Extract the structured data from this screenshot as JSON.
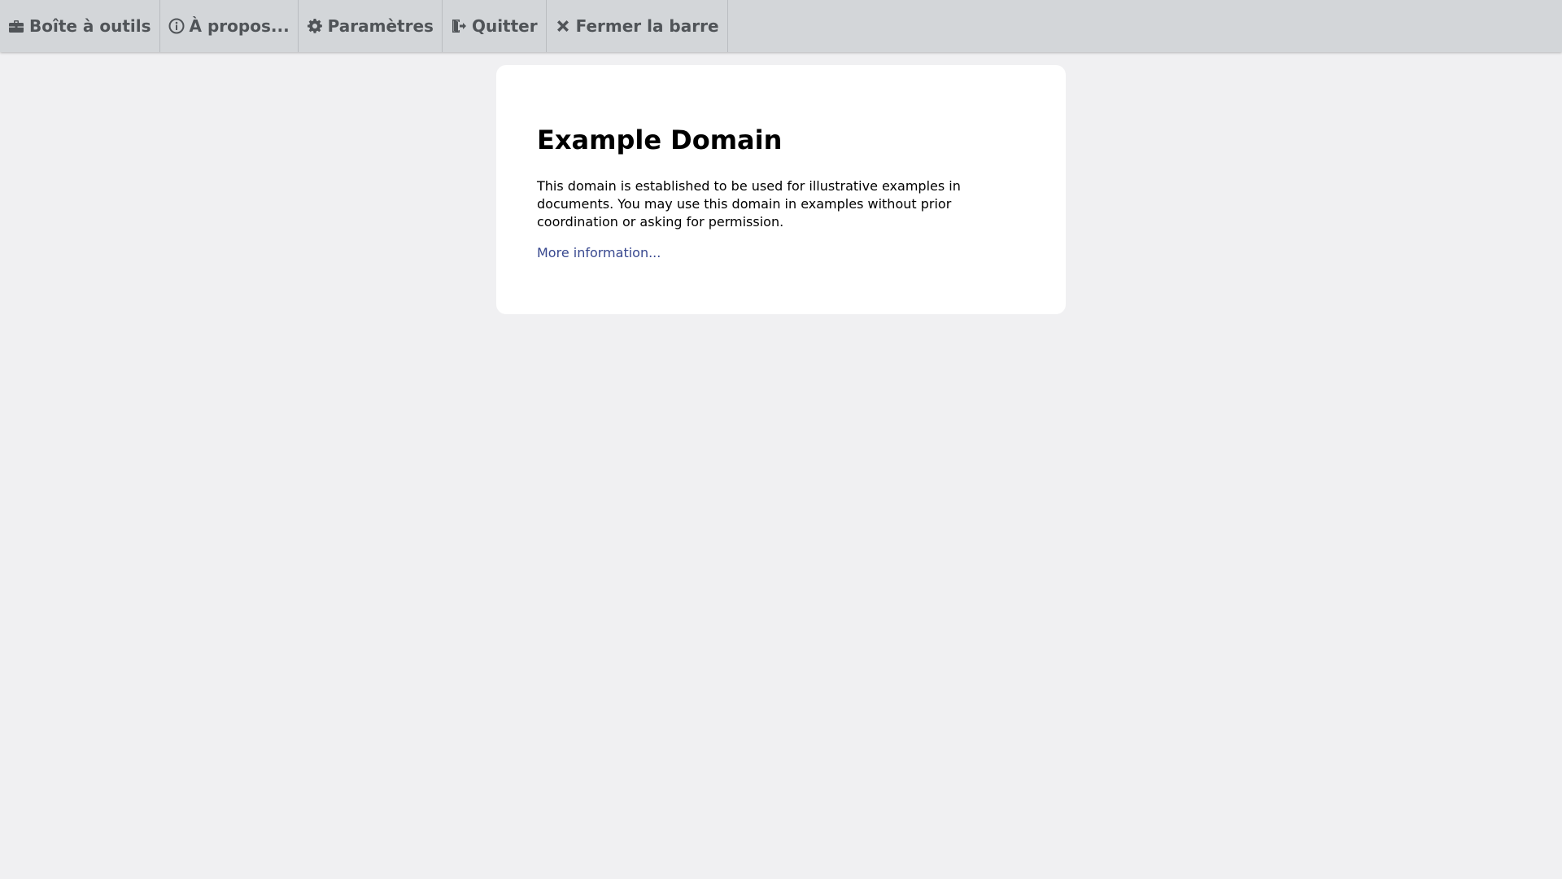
{
  "toolbar": {
    "items": [
      {
        "label": "Boîte à outils",
        "icon": "toolbox-icon"
      },
      {
        "label": "À propos...",
        "icon": "info-circle-icon"
      },
      {
        "label": "Paramètres",
        "icon": "gear-icon"
      },
      {
        "label": "Quitter",
        "icon": "exit-door-icon"
      },
      {
        "label": "Fermer la barre",
        "icon": "close-x-icon"
      }
    ],
    "background": "#d3d6d9",
    "text_color": "#505458"
  },
  "page": {
    "heading": "Example Domain",
    "paragraph": "This domain is established to be used for illustrative examples in documents. You may use this domain in examples without prior coordination or asking for permission.",
    "link_text": "More information...",
    "background": "#f0f0f2",
    "link_color": "#38488f"
  }
}
